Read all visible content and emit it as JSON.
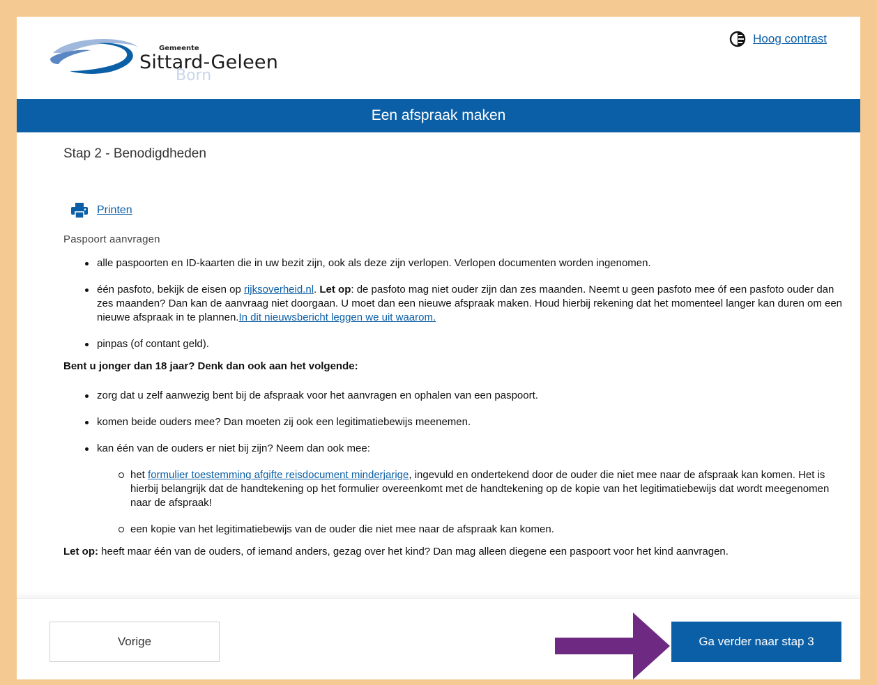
{
  "header": {
    "logo_small": "Gemeente",
    "logo_name": "Sittard-Geleen",
    "logo_sub": "Born",
    "contrast_label": "Hoog contrast"
  },
  "titlebar": {
    "title": "Een afspraak maken"
  },
  "main": {
    "step_title": "Stap 2 - Benodigdheden",
    "print_label": "Printen",
    "section_title": "Paspoort aanvragen",
    "items": {
      "item1": "alle paspoorten en ID-kaarten die in uw bezit zijn, ook als deze zijn verlopen. Verlopen documenten worden ingenomen.",
      "item2_a": "één pasfoto, bekijk de eisen op ",
      "item2_link": "rijksoverheid.nl",
      "item2_b": ". ",
      "item2_bold": "Let op",
      "item2_c": ": de pasfoto mag niet ouder zijn dan zes maanden. Neemt u geen pasfoto mee óf een pasfoto ouder dan zes maanden? Dan kan de aanvraag niet doorgaan. U moet dan een nieuwe afspraak maken. Houd hierbij rekening dat het momenteel langer kan duren om een nieuwe afspraak in te plannen.",
      "item2_link2": "In dit nieuwsbericht leggen we uit waarom.",
      "item3": "pinpas (of contant geld)."
    },
    "minor_heading": "Bent u jonger dan 18 jaar? Denk dan ook aan het volgende:",
    "minor_items": {
      "m1": "zorg dat u zelf aanwezig bent bij de afspraak voor het aanvragen en ophalen van een paspoort.",
      "m2": "komen beide ouders mee? Dan moeten zij ook een legitimatiebewijs meenemen.",
      "m3": "kan één van de ouders er niet bij zijn? Neem dan ook mee:",
      "sub1_a": "het ",
      "sub1_link": "formulier toestemming afgifte reisdocument minderjarige",
      "sub1_b": ", ingevuld en ondertekend door de ouder die niet mee naar de afspraak kan komen. Het is hierbij belangrijk dat de handtekening op het formulier overeenkomt met de handtekening op de kopie van het legitimatiebewijs dat wordt meegenomen naar de afspraak!",
      "sub2": "een kopie van het legitimatiebewijs van de ouder die niet mee naar de afspraak kan komen."
    },
    "note_bold": "Let op:",
    "note_text": " heeft maar één van de ouders, of iemand anders, gezag over het kind? Dan mag alleen diegene een paspoort voor het kind aanvragen."
  },
  "footer": {
    "prev_label": "Vorige",
    "next_label": "Ga verder naar stap 3"
  },
  "colors": {
    "brand_blue": "#0b5fa6",
    "page_border": "#f5c992",
    "arrow_purple": "#6e2a82"
  },
  "icons": {
    "contrast": "contrast-icon",
    "print": "printer-icon",
    "arrow": "arrow-right-icon"
  }
}
